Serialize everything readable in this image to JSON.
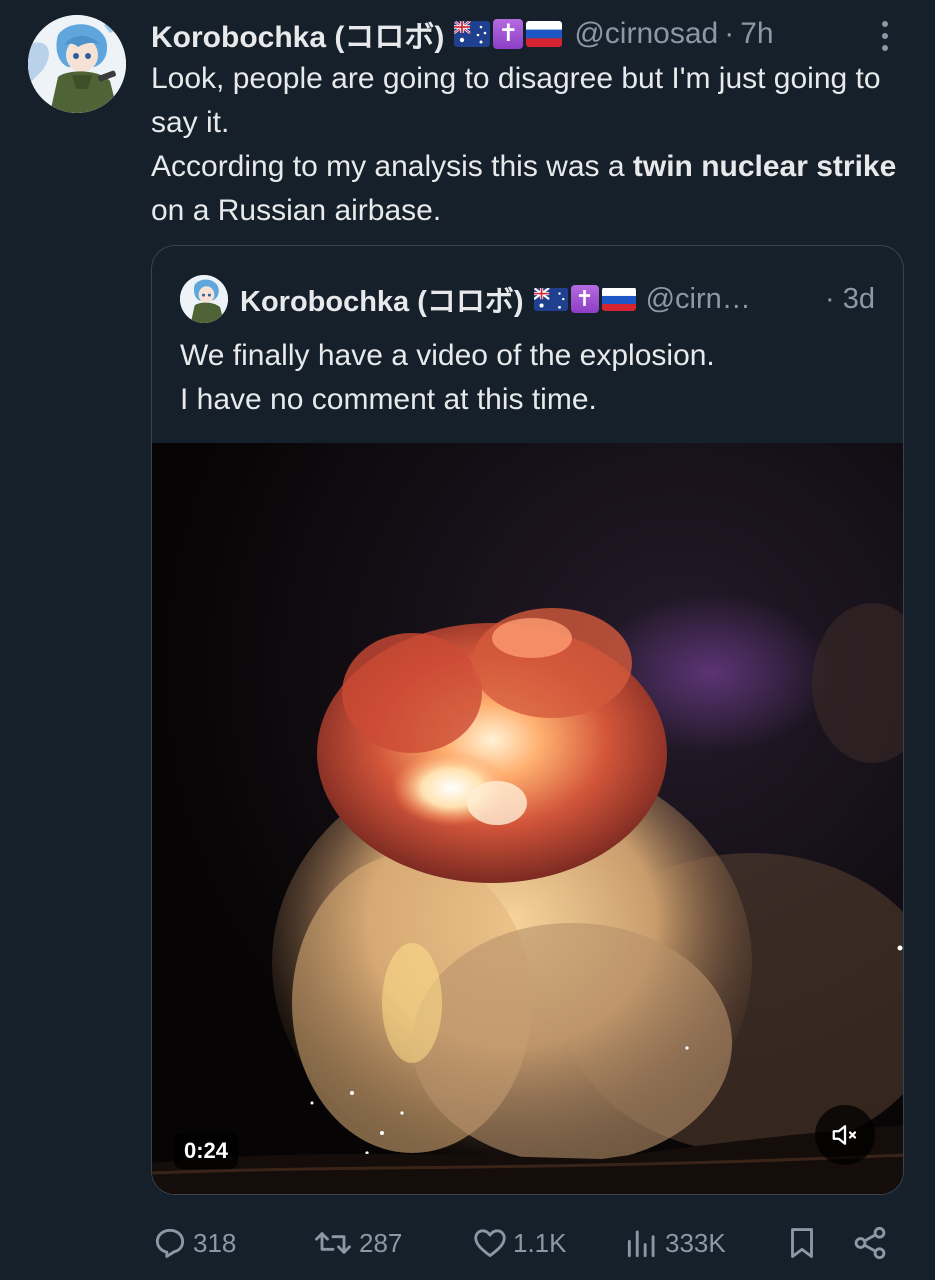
{
  "tweet": {
    "display_name": "Korobochka (コロボ)",
    "handle": "@cirnosad",
    "separator": "·",
    "time": "7h",
    "text_line1": "Look, people are going to disagree but I'm just going to say it.",
    "text_line2_prefix": "According to my analysis this was a ",
    "text_line2_bold": "twin nuclear strike",
    "text_line2_suffix": " on a Russian airbase.",
    "flags": [
      "australia-flag-icon",
      "latin-cross-icon",
      "russia-flag-icon"
    ],
    "cross_glyph": "✝"
  },
  "quote": {
    "display_name": "Korobochka (コロボ)",
    "handle": "@cirn…",
    "time": "· 3d",
    "text_line1": "We finally have a video of the explosion.",
    "text_line2": "I have no comment at this time.",
    "cross_glyph": "✝",
    "video": {
      "duration": "0:24",
      "muted": true
    }
  },
  "actions": {
    "replies": "318",
    "reposts": "287",
    "likes": "1.1K",
    "views": "333K"
  },
  "colors": {
    "background": "#15202b",
    "text": "#e7e9ea",
    "secondary": "#8b98a5",
    "border": "#38444d"
  }
}
